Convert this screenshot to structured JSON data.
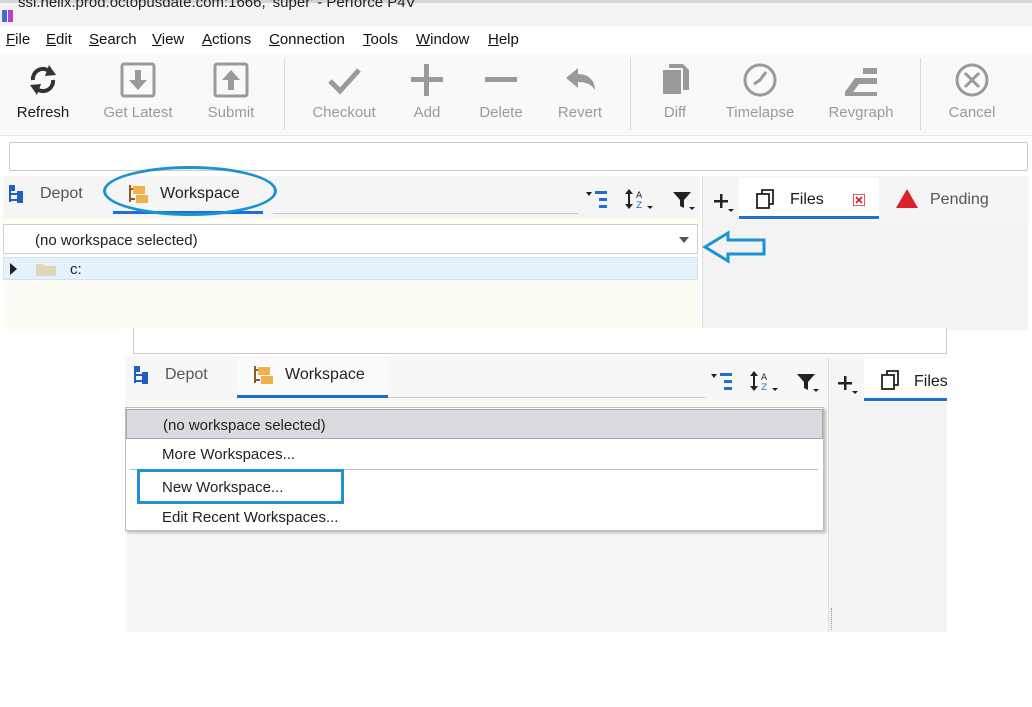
{
  "window": {
    "title": "ssl.helix.prod.octopusdate.com:1666, 'super' - Perforce P4V"
  },
  "menubar": [
    "File",
    "Edit",
    "Search",
    "View",
    "Actions",
    "Connection",
    "Tools",
    "Window",
    "Help"
  ],
  "toolbar": {
    "refresh": "Refresh",
    "get_latest": "Get Latest",
    "submit": "Submit",
    "checkout": "Checkout",
    "add": "Add",
    "delete": "Delete",
    "revert": "Revert",
    "diff": "Diff",
    "timelapse": "Timelapse",
    "revgraph": "Revgraph",
    "cancel": "Cancel"
  },
  "left_tabs": {
    "depot": "Depot",
    "workspace": "Workspace"
  },
  "right_tabs": {
    "files": "Files",
    "pending": "Pending"
  },
  "workspace_selector": {
    "value": "(no workspace selected)"
  },
  "tree": {
    "root": "c:"
  },
  "dropdown": {
    "items": [
      "(no workspace selected)",
      "More Workspaces...",
      "New Workspace...",
      "Edit Recent Workspaces..."
    ]
  },
  "colors": {
    "accent": "#1f6fd1",
    "annotation": "#1a92d3",
    "error_red": "#d8232a"
  }
}
